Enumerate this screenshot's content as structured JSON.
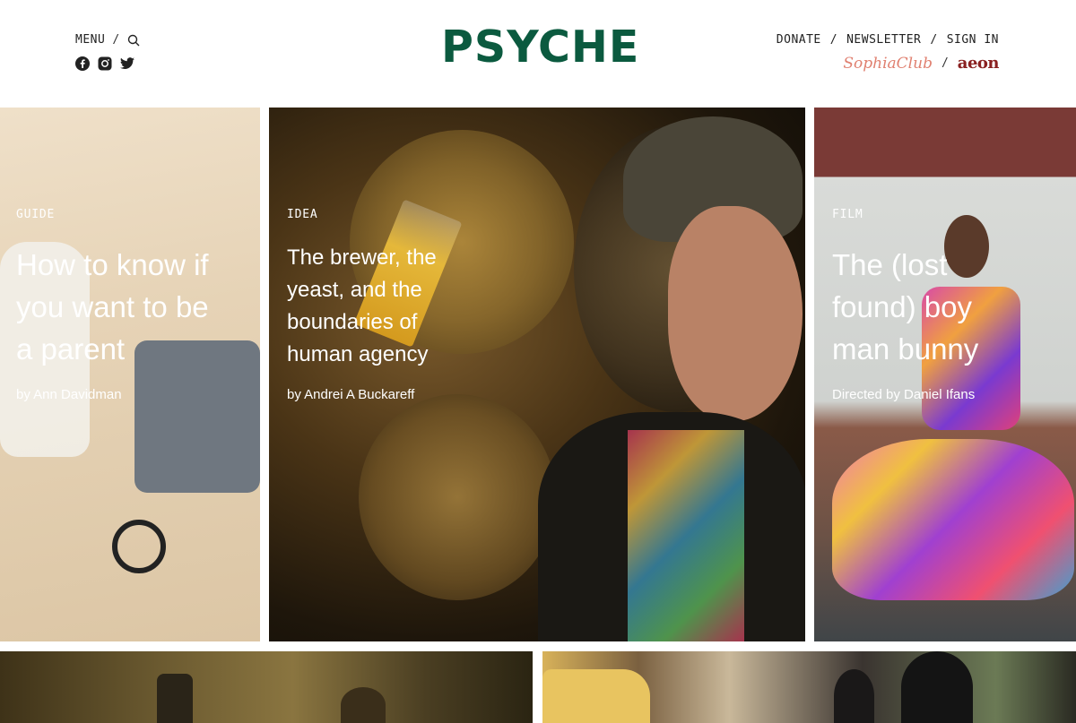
{
  "header": {
    "menu_label": "MENU",
    "logo": "PSYCHE",
    "nav_right": [
      "DONATE",
      "NEWSLETTER",
      "SIGN IN"
    ],
    "partners": {
      "sophia": "SophiaClub",
      "aeon": "aeon"
    },
    "socials": [
      "facebook-icon",
      "instagram-icon",
      "twitter-icon"
    ]
  },
  "cards": [
    {
      "category": "GUIDE",
      "title": "How to know if you want to be a parent",
      "byline": "by Ann Davidman"
    },
    {
      "category": "IDEA",
      "title": "The brewer, the yeast, and the boundaries of human agency",
      "byline": "by Andrei A Buckareff"
    },
    {
      "category": "FILM",
      "title": "The (lost found) boy man bunny",
      "byline": "Directed by Daniel Ifans"
    }
  ],
  "colors": {
    "logo": "#0b5a3f",
    "sophia": "#e08070",
    "aeon": "#8a2020"
  }
}
